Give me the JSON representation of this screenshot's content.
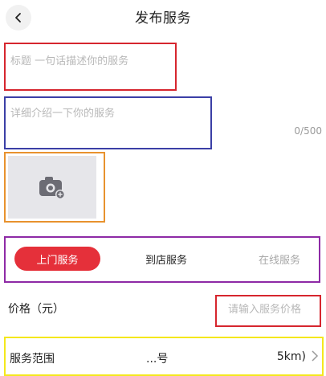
{
  "header": {
    "title": "发布服务",
    "back_icon": "chevron-left-icon"
  },
  "form": {
    "title_placeholder": "标题 一句话描述你的服务",
    "description_placeholder": "详细介绍一下你的服务",
    "description_counter": "0/500",
    "photo_icon": "camera-add-icon"
  },
  "service_type": {
    "options": [
      "上门服务",
      "到店服务",
      "在线服务"
    ],
    "selected": "上门服务",
    "accent_color": "#e5303a"
  },
  "price": {
    "label": "价格（元）",
    "placeholder": "请输入服务价格"
  },
  "area": {
    "label": "服务范围",
    "value": "...号",
    "radius": "5km)",
    "chevron_icon": "chevron-right-icon"
  }
}
